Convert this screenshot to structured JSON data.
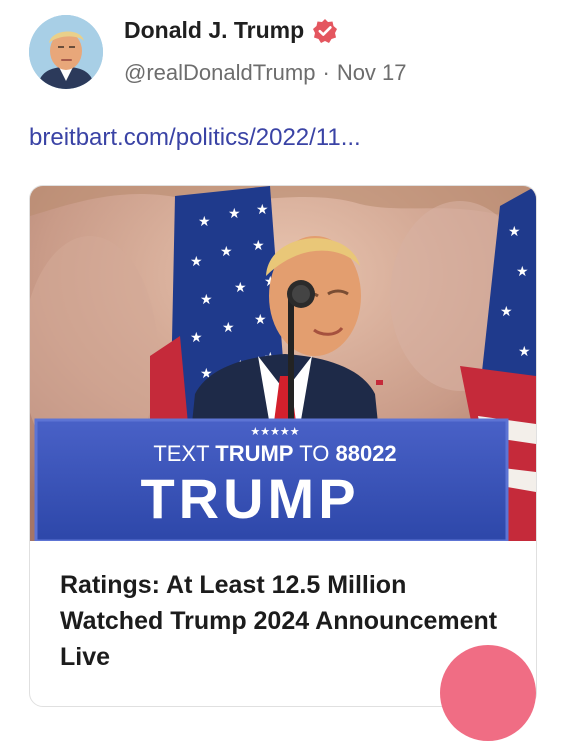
{
  "post": {
    "author_name": "Donald J. Trump",
    "verified_icon": "verified-badge-icon",
    "handle": "@realDonaldTrump",
    "separator": "·",
    "date": "Nov 17",
    "link_text": "breitbart.com/politics/2022/11..."
  },
  "card": {
    "image": {
      "stars": "★★★★★",
      "podium_line1_a": "TEXT",
      "podium_line1_b": "TRUMP",
      "podium_line1_c": "TO",
      "podium_line1_d": "88022",
      "podium_main": "TRUMP"
    },
    "title": "Ratings: At Least 12.5 Million Watched Trump 2024 Announcement Live"
  },
  "colors": {
    "link": "#3a43a5",
    "verified": "#e4565f",
    "podium_blue": "#3b52b4",
    "fab": "#f06d84"
  }
}
